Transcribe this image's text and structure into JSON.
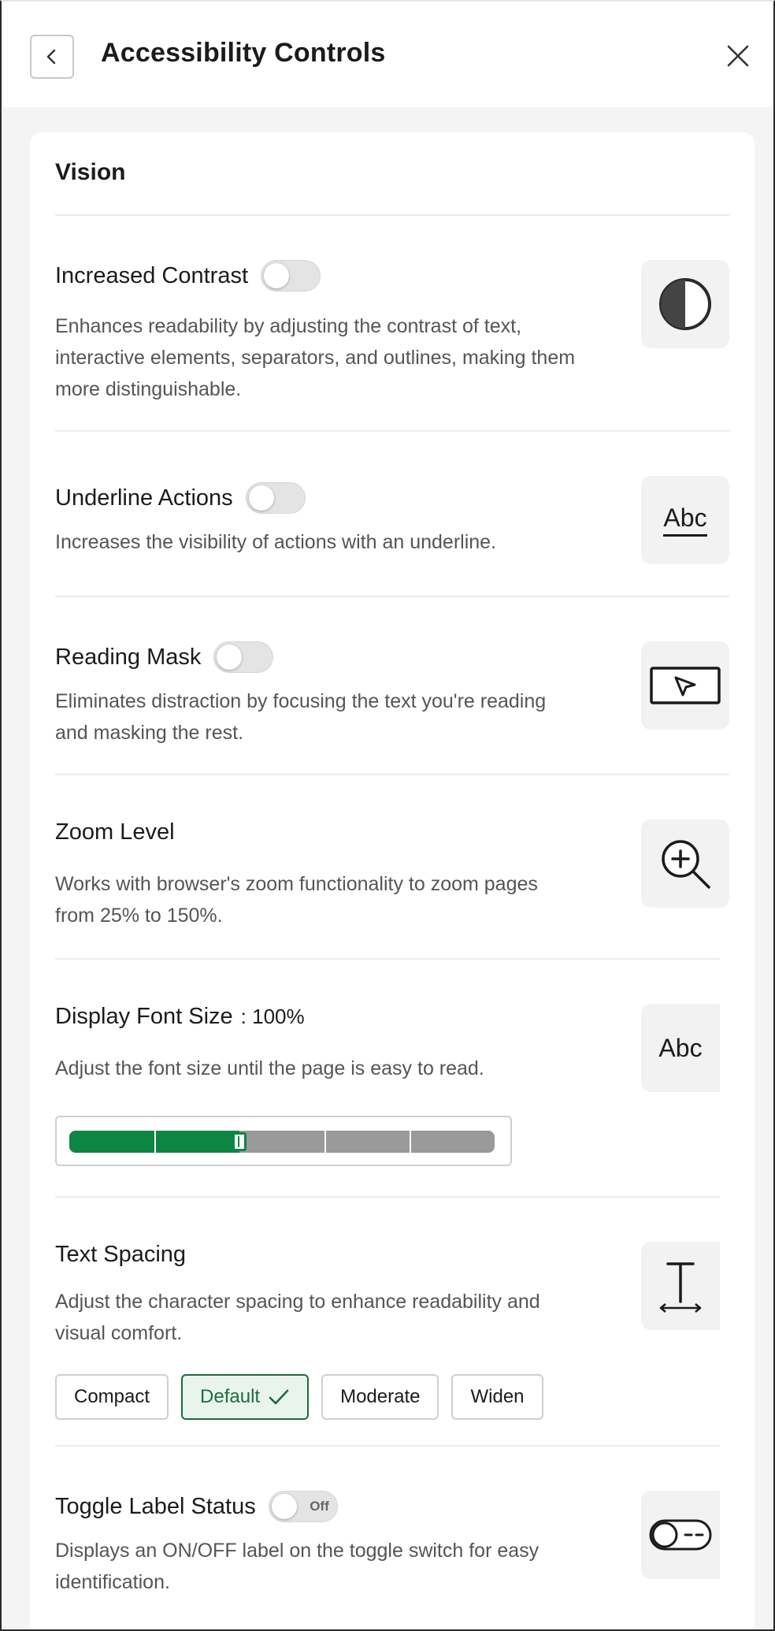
{
  "header": {
    "title": "Accessibility Controls",
    "back_icon": "chevron-left-icon",
    "close_icon": "close-icon"
  },
  "vision": {
    "section_title": "Vision",
    "increased_contrast": {
      "title": "Increased Contrast",
      "toggle_on": false,
      "desc_lines": [
        "Enhances readability by adjusting the contrast of text,",
        "interactive elements, separators, and outlines, making them",
        "more distinguishable."
      ],
      "icon": "contrast-icon"
    },
    "underline_actions": {
      "title": "Underline Actions",
      "toggle_on": false,
      "desc_lines": [
        "Increases the visibility of actions with an underline."
      ],
      "icon_text": "Abc"
    },
    "reading_mask": {
      "title": "Reading Mask",
      "toggle_on": false,
      "desc_lines": [
        "Eliminates distraction by focusing the text you're reading",
        "and masking the rest."
      ],
      "icon": "reading-mask-icon"
    },
    "zoom_level": {
      "title": "Zoom Level",
      "desc_lines": [
        "Works with browser's zoom functionality to zoom pages",
        "from 25% to 150%."
      ],
      "icon": "zoom-in-icon"
    },
    "display_font_size": {
      "title": "Display Font Size",
      "value_text": ": 100%",
      "desc_lines": [
        "Adjust the font size until the page is easy to read."
      ],
      "icon_text": "Abc",
      "slider_steps": 6,
      "slider_selected_step": 2,
      "slider_fill_fraction": 0.4
    },
    "text_spacing": {
      "title": "Text Spacing",
      "desc_lines": [
        "Adjust the character spacing to enhance readability and",
        "visual comfort."
      ],
      "icon": "text-spacing-icon",
      "options": [
        "Compact",
        "Default",
        "Moderate",
        "Widen"
      ],
      "selected": "Default"
    },
    "toggle_label_status": {
      "title": "Toggle Label Status",
      "toggle_label": "Off",
      "toggle_on": false,
      "desc_lines": [
        "Displays an ON/OFF label on the toggle switch for easy",
        "identification."
      ],
      "icon": "toggle-off-icon"
    }
  },
  "colors": {
    "accent_green": "#0f8544",
    "track_gray": "#9a9a9a",
    "panel_bg": "#f4f4f4"
  }
}
